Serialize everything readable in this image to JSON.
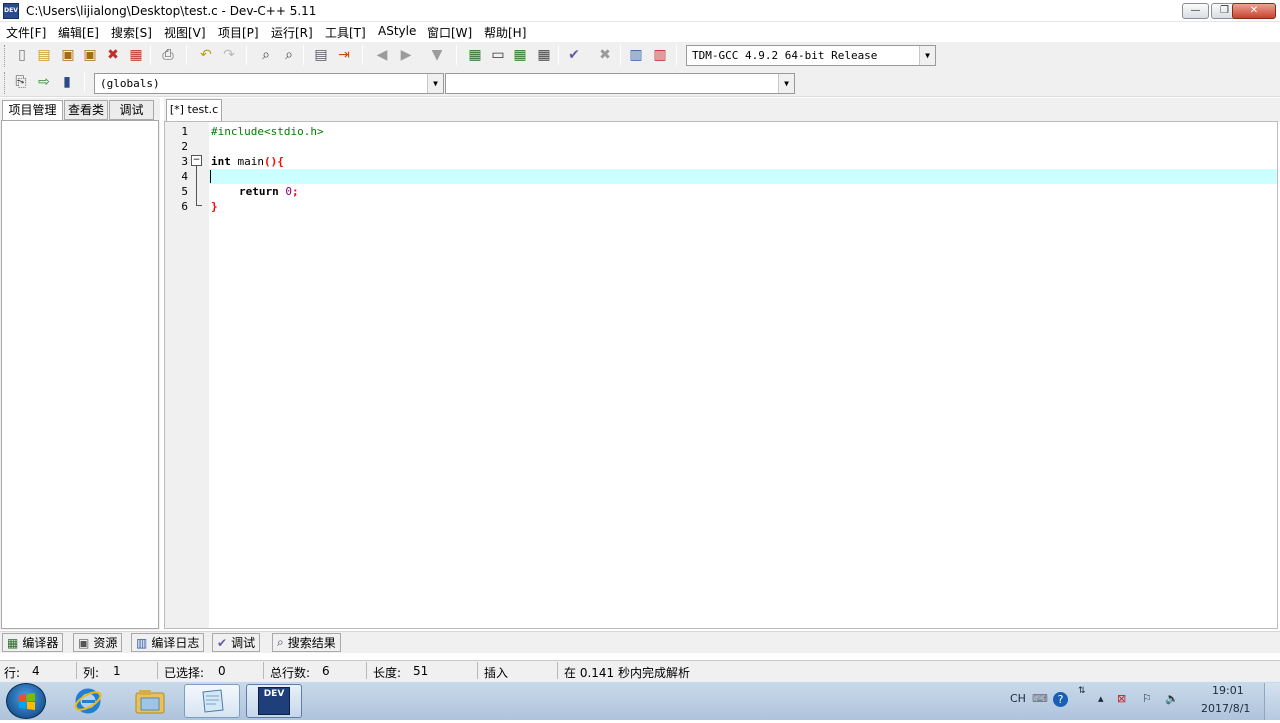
{
  "window": {
    "app_icon_label": "DEV",
    "title": "C:\\Users\\lijialong\\Desktop\\test.c - Dev-C++ 5.11",
    "controls": {
      "minimize": "—",
      "maximize": "❐",
      "close": "✕"
    }
  },
  "menu": [
    "文件[F]",
    "编辑[E]",
    "搜索[S]",
    "视图[V]",
    "项目[P]",
    "运行[R]",
    "工具[T]",
    "AStyle",
    "窗口[W]",
    "帮助[H]"
  ],
  "toolbar": {
    "compiler": "TDM-GCC 4.9.2 64-bit Release",
    "scope": "(globals)",
    "member": ""
  },
  "left_panel": {
    "tabs": [
      "项目管理",
      "查看类",
      "调试"
    ]
  },
  "editor": {
    "tab": "[*] test.c",
    "line_numbers": [
      "1",
      "2",
      "3",
      "4",
      "5",
      "6"
    ],
    "code": {
      "line1": "#include<stdio.h>",
      "line3_kw": "int",
      "line3_name": " main",
      "line3_sym": "(){",
      "line5_kw": "return",
      "line5_num": "0",
      "line5_sym": ";",
      "line6_sym": "}"
    },
    "fold_marker": "−",
    "current_line": 4
  },
  "bottom_tabs": [
    {
      "label": "编译器",
      "icon": "grid-icon"
    },
    {
      "label": "资源",
      "icon": "resources-icon"
    },
    {
      "label": "编译日志",
      "icon": "chart-icon"
    },
    {
      "label": "调试",
      "icon": "check-icon"
    },
    {
      "label": "搜索结果",
      "icon": "search-icon"
    }
  ],
  "status": {
    "row_label": "行:",
    "row": "4",
    "col_label": "列:",
    "col": "1",
    "sel_label": "已选择:",
    "sel": "0",
    "total_label": "总行数:",
    "total": "6",
    "len_label": "长度:",
    "len": "51",
    "mode": "插入",
    "parse": "在 0.141 秒内完成解析"
  },
  "taskbar": {
    "ime": "CH",
    "time": "19:01",
    "date": "2017/8/1",
    "dev_label": "DEV"
  },
  "colors": {
    "current_line": "#ccffff",
    "keyword_symbol": "#ff0000",
    "preprocessor": "#008000",
    "number": "#800080"
  }
}
